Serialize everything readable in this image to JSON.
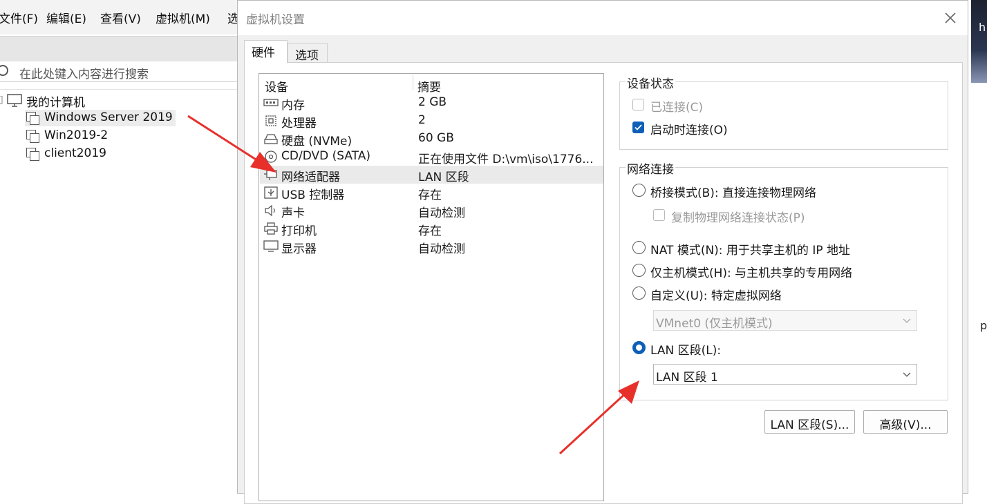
{
  "app": {
    "menu": [
      "文件(F)",
      "编辑(E)",
      "查看(V)",
      "虚拟机(M)",
      "选"
    ],
    "search_placeholder": "在此处键入内容进行搜索",
    "tree": {
      "root": "我的计算机",
      "vms": [
        "Windows Server 2019",
        "Win2019-2",
        "client2019"
      ]
    }
  },
  "dialog": {
    "title": "虚拟机设置",
    "tabs": [
      "硬件",
      "选项"
    ],
    "device_list": {
      "headers": [
        "设备",
        "摘要"
      ],
      "rows": [
        {
          "icon": "memory-icon",
          "name": "内存",
          "summary": "2 GB"
        },
        {
          "icon": "cpu-icon",
          "name": "处理器",
          "summary": "2"
        },
        {
          "icon": "disk-icon",
          "name": "硬盘 (NVMe)",
          "summary": "60 GB"
        },
        {
          "icon": "cd-icon",
          "name": "CD/DVD (SATA)",
          "summary": "正在使用文件 D:\\vm\\iso\\1776..."
        },
        {
          "icon": "network-adapter-icon",
          "name": "网络适配器",
          "summary": "LAN 区段"
        },
        {
          "icon": "usb-icon",
          "name": "USB 控制器",
          "summary": "存在"
        },
        {
          "icon": "speaker-icon",
          "name": "声卡",
          "summary": "自动检测"
        },
        {
          "icon": "printer-icon",
          "name": "打印机",
          "summary": "存在"
        },
        {
          "icon": "display-icon",
          "name": "显示器",
          "summary": "自动检测"
        }
      ],
      "selected_index": 4
    },
    "device_status": {
      "title": "设备状态",
      "connected": {
        "label": "已连接(C)",
        "checked": false,
        "disabled": true
      },
      "connect_at_power_on": {
        "label": "启动时连接(O)",
        "checked": true
      }
    },
    "network_connection": {
      "title": "网络连接",
      "bridged": {
        "label": "桥接模式(B): 直接连接物理网络",
        "selected": false
      },
      "replicate": {
        "label": "复制物理网络连接状态(P)",
        "checked": false,
        "disabled": true
      },
      "nat": {
        "label": "NAT 模式(N): 用于共享主机的 IP 地址",
        "selected": false
      },
      "host_only": {
        "label": "仅主机模式(H): 与主机共享的专用网络",
        "selected": false
      },
      "custom": {
        "label": "自定义(U): 特定虚拟网络",
        "selected": false
      },
      "custom_value": "VMnet0 (仅主机模式)",
      "lan_segment": {
        "label": "LAN 区段(L):",
        "selected": true
      },
      "lan_segment_value": "LAN 区段 1"
    },
    "buttons": {
      "lan_segments": "LAN 区段(S)...",
      "advanced": "高级(V)..."
    }
  },
  "edge_text": [
    "h",
    "p"
  ],
  "colors": {
    "accent": "#0f5fb8",
    "arrow": "#e8302b"
  }
}
